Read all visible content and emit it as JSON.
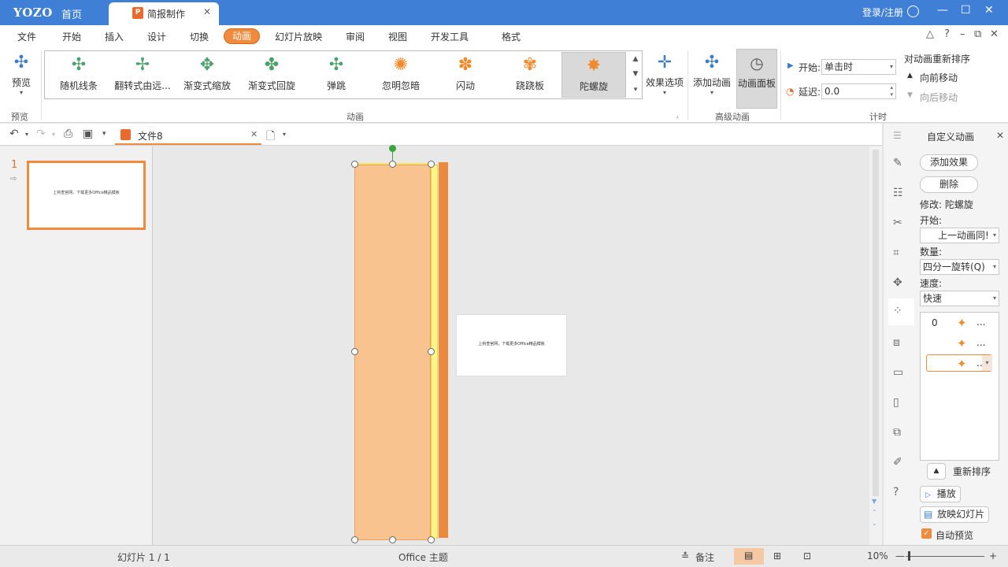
{
  "titlebar": {
    "logo": "YOZO",
    "home_tab": "首页",
    "doc_tab": "简报制作",
    "doc_tab_icon": "P",
    "login": "登录/注册"
  },
  "menu": {
    "items": [
      "文件",
      "开始",
      "插入",
      "设计",
      "切换",
      "动画",
      "幻灯片放映",
      "审阅",
      "视图",
      "开发工具",
      "格式"
    ],
    "active": "动画"
  },
  "ribbon": {
    "preview": {
      "label": "预览",
      "group": "预览"
    },
    "animations": [
      {
        "label": "随机线条",
        "color": "#4aa26a"
      },
      {
        "label": "翻转式由远...",
        "color": "#4aa26a"
      },
      {
        "label": "渐变式缩放",
        "color": "#4aa26a"
      },
      {
        "label": "渐变式回旋",
        "color": "#4aa26a"
      },
      {
        "label": "弹跳",
        "color": "#4aa26a"
      },
      {
        "label": "忽明忽暗",
        "color": "#ef8b2c"
      },
      {
        "label": "闪动",
        "color": "#ef8b2c"
      },
      {
        "label": "跷跷板",
        "color": "#ef8b2c"
      },
      {
        "label": "陀螺旋",
        "color": "#ef8b2c",
        "selected": true
      }
    ],
    "effect_options": "效果选项",
    "group_animation": "动画",
    "add_animation": "添加动画",
    "anim_pane": "动画面板",
    "group_advanced": "高级动画",
    "start_label": "开始:",
    "start_value": "单击时",
    "delay_label": "延迟:",
    "delay_value": "0.0",
    "group_timing": "计时",
    "reorder_title": "对动画重新排序",
    "move_forward": "向前移动",
    "move_backward": "向后移动"
  },
  "toolbar2": {
    "file_tab": "文件8"
  },
  "slides": {
    "number": "1",
    "thumb_text": "上钩查官网，下载更多Office精品模板"
  },
  "slide_card_text": "上钩查官网，下载更多Office精品模板",
  "right_pane": {
    "title": "自定义动画",
    "add_effect": "添加效果",
    "delete": "删除",
    "modify": "修改: 陀螺旋",
    "start_label": "开始:",
    "start_value": "上一动画同!",
    "amount_label": "数量:",
    "amount_value": "四分一旋转(Q)",
    "speed_label": "速度:",
    "speed_value": "快速",
    "list": [
      {
        "num": "0",
        "dots": "..."
      },
      {
        "num": "",
        "dots": "..."
      },
      {
        "num": "",
        "dots": "...",
        "selected": true
      }
    ],
    "reorder": "重新排序",
    "play": "播放",
    "slideshow": "放映幻灯片",
    "autopreview": "自动预览"
  },
  "status": {
    "slide_info": "幻灯片 1 / 1",
    "theme": "Office 主题",
    "notes": "备注",
    "zoom": "10%"
  }
}
